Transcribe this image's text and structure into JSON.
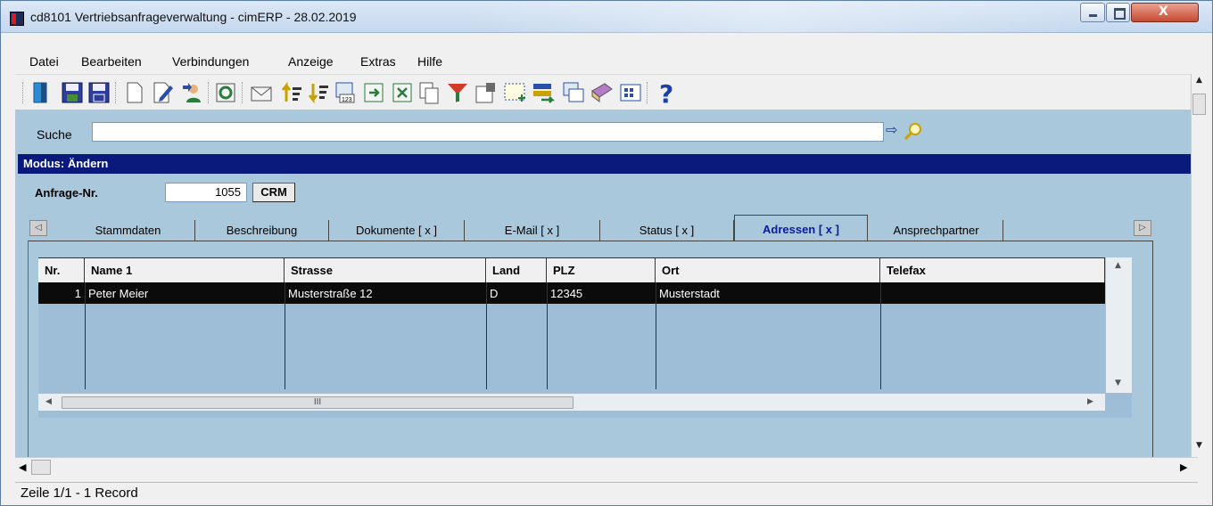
{
  "window": {
    "title": "cd8101 Vertriebsanfrageverwaltung - cimERP - 28.02.2019"
  },
  "menu": [
    "Datei",
    "Bearbeiten",
    "Verbindungen",
    "Anzeige",
    "Extras",
    "Hilfe"
  ],
  "toolbar": {
    "icons": [
      "exit-door-icon",
      "save-copy-icon",
      "save-icon",
      "new-document-icon",
      "edit-document-icon",
      "copy-user-icon",
      "refresh-icon",
      "mail-icon",
      "sort-ascending-icon",
      "sort-descending-icon",
      "number-list-icon",
      "export-icon",
      "excel-icon",
      "copy-doc-icon",
      "filter-icon",
      "properties-icon",
      "select-icon",
      "transfer-icon",
      "windows-icon",
      "book-icon",
      "grid-icon",
      "help-icon"
    ]
  },
  "search": {
    "label": "Suche",
    "value": ""
  },
  "mode": {
    "text": "Modus: Ändern"
  },
  "request": {
    "label": "Anfrage-Nr.",
    "number": "1055",
    "crm_label": "CRM"
  },
  "tabs": [
    {
      "label": "Stammdaten",
      "active": false
    },
    {
      "label": "Beschreibung",
      "active": false
    },
    {
      "label": "Dokumente [ x ]",
      "active": false
    },
    {
      "label": "E-Mail [ x ]",
      "active": false
    },
    {
      "label": "Status [ x ]",
      "active": false
    },
    {
      "label": "Adressen [ x ]",
      "active": true
    },
    {
      "label": "Ansprechpartner",
      "active": false
    }
  ],
  "grid": {
    "columns": [
      "Nr.",
      "Name 1",
      "Strasse",
      "Land",
      "PLZ",
      "Ort",
      "Telefax"
    ],
    "rows": [
      [
        "1",
        "Peter Meier",
        "Musterstraße 12",
        "D",
        "12345",
        "Musterstadt",
        ""
      ]
    ],
    "hscroll_grip": "III"
  },
  "status": {
    "text": "Zeile 1/1 - 1 Record"
  },
  "colors": {
    "mode_bar": "#0a1a7c",
    "panel": "#a9c8dc",
    "selected_row": "#0b0b0b",
    "active_tab_text": "#0b1a9e"
  }
}
